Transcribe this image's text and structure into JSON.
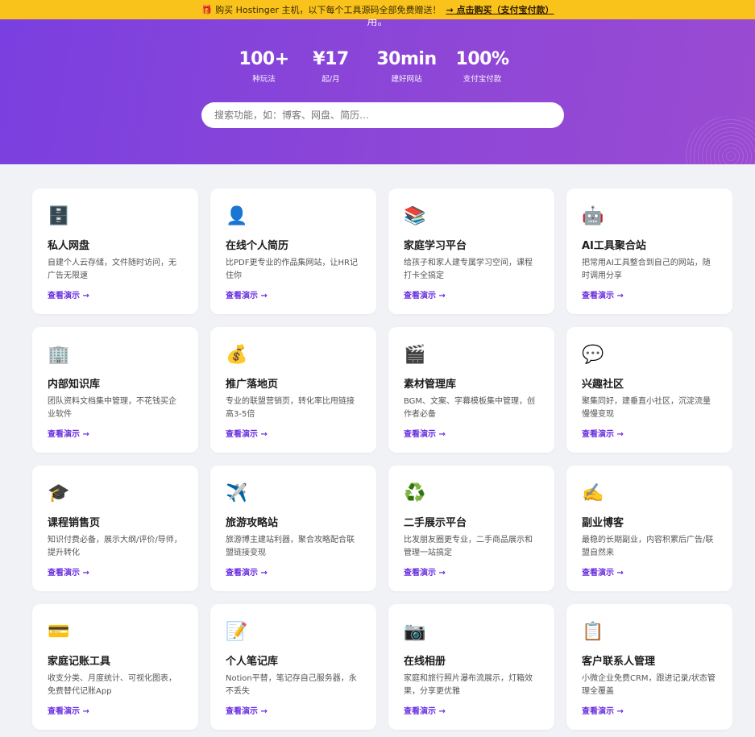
{
  "promo": {
    "gift_icon": "gift-icon",
    "text": "购买 Hostinger 主机，以下每个工具源码全部免费赠送！",
    "cta": "→ 点击购买（支付宝付款）"
  },
  "hero": {
    "cut_text": "用。",
    "stats": [
      {
        "value": "100+",
        "label": "种玩法"
      },
      {
        "value": "¥17",
        "label": "起/月"
      },
      {
        "value": "30min",
        "label": "建好网站"
      },
      {
        "value": "100%",
        "label": "支付宝付款"
      }
    ],
    "search_placeholder": "搜索功能，如：博客、网盘、简历…"
  },
  "cards": [
    {
      "icon": "file-cabinet-icon",
      "title": "私人网盘",
      "desc": "自建个人云存储，文件随时访问，无广告无限速",
      "link": "查看演示 →"
    },
    {
      "icon": "person-silhouette-icon",
      "title": "在线个人简历",
      "desc": "比PDF更专业的作品集网站，让HR记住你",
      "link": "查看演示 →"
    },
    {
      "icon": "books-icon",
      "title": "家庭学习平台",
      "desc": "给孩子和家人建专属学习空间，课程打卡全搞定",
      "link": "查看演示 →"
    },
    {
      "icon": "robot-icon",
      "title": "AI工具聚合站",
      "desc": "把常用AI工具整合到自己的网站，随时调用分享",
      "link": "查看演示 →"
    },
    {
      "icon": "office-building-icon",
      "title": "内部知识库",
      "desc": "团队资料文档集中管理，不花钱买企业软件",
      "link": "查看演示 →"
    },
    {
      "icon": "money-bag-icon",
      "title": "推广落地页",
      "desc": "专业的联盟营销页，转化率比甩链接高3-5倍",
      "link": "查看演示 →"
    },
    {
      "icon": "clapper-board-icon",
      "title": "素材管理库",
      "desc": "BGM、文案、字幕模板集中管理，创作者必备",
      "link": "查看演示 →"
    },
    {
      "icon": "speech-bubble-icon",
      "title": "兴趣社区",
      "desc": "聚集同好，建垂直小社区，沉淀流量慢慢变现",
      "link": "查看演示 →"
    },
    {
      "icon": "graduation-cap-icon",
      "title": "课程销售页",
      "desc": "知识付费必备，展示大纲/评价/导师，提升转化",
      "link": "查看演示 →"
    },
    {
      "icon": "airplane-icon",
      "title": "旅游攻略站",
      "desc": "旅游博主建站利器，聚合攻略配合联盟链接变现",
      "link": "查看演示 →"
    },
    {
      "icon": "recycle-icon",
      "title": "二手展示平台",
      "desc": "比发朋友圈更专业，二手商品展示和管理一站搞定",
      "link": "查看演示 →"
    },
    {
      "icon": "writing-hand-icon",
      "title": "副业博客",
      "desc": "最稳的长期副业，内容积累后广告/联盟自然来",
      "link": "查看演示 →"
    },
    {
      "icon": "credit-card-icon",
      "title": "家庭记账工具",
      "desc": "收支分类、月度统计、可视化图表，免费替代记账App",
      "link": "查看演示 →"
    },
    {
      "icon": "memo-icon",
      "title": "个人笔记库",
      "desc": "Notion平替，笔记存自己服务器，永不丢失",
      "link": "查看演示 →"
    },
    {
      "icon": "camera-icon",
      "title": "在线相册",
      "desc": "家庭和旅行照片瀑布流展示，灯箱效果，分享更优雅",
      "link": "查看演示 →"
    },
    {
      "icon": "clipboard-icon",
      "title": "客户联系人管理",
      "desc": "小微企业免费CRM，跟进记录/状态管理全覆盖",
      "link": "查看演示 →"
    }
  ]
}
